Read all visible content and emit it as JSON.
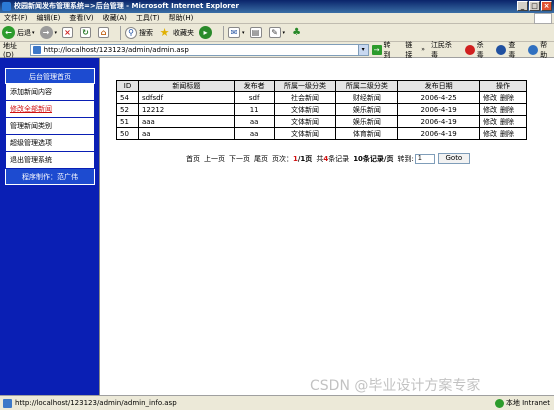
{
  "window": {
    "title": "校园新闻发布管理系统=>后台管理 - Microsoft Internet Explorer"
  },
  "menu": [
    "文件(F)",
    "编辑(E)",
    "查看(V)",
    "收藏(A)",
    "工具(T)",
    "帮助(H)"
  ],
  "toolbar": {
    "back": "后退",
    "search": "搜索",
    "favorites": "收藏夹"
  },
  "address": {
    "label": "地址(D)",
    "url": "http://localhost/123123/admin/admin.asp",
    "go": "转到",
    "links": "链接",
    "ext1": "江民杀毒",
    "ext2": "杀毒",
    "ext3": "查毒",
    "ext4": "帮助"
  },
  "sidebar": {
    "header": "后台管理首页",
    "items": [
      {
        "label": "添加新闻内容",
        "active": false
      },
      {
        "label": "修改全部新闻",
        "active": true
      },
      {
        "label": "管理新闻类别",
        "active": false
      },
      {
        "label": "超级管理选项",
        "active": false
      },
      {
        "label": "退出管理系统",
        "active": false
      }
    ],
    "footer": "程序制作：范广伟"
  },
  "table": {
    "headers": [
      "ID",
      "新闻标题",
      "发布者",
      "所属一级分类",
      "所属二级分类",
      "发布日期",
      "操作"
    ],
    "rows": [
      {
        "id": "54",
        "title": "sdfsdf",
        "author": "sdf",
        "cat1": "社会新闻",
        "cat2": "财经新闻",
        "date": "2006-4-25"
      },
      {
        "id": "52",
        "title": "12212",
        "author": "11",
        "cat1": "文体新闻",
        "cat2": "娱乐新闻",
        "date": "2006-4-19"
      },
      {
        "id": "51",
        "title": "aaa",
        "author": "aa",
        "cat1": "文体新闻",
        "cat2": "娱乐新闻",
        "date": "2006-4-19"
      },
      {
        "id": "50",
        "title": "aa",
        "author": "aa",
        "cat1": "文体新闻",
        "cat2": "体育新闻",
        "date": "2006-4-19"
      }
    ],
    "edit_label": "修改",
    "delete_label": "删除"
  },
  "pager": {
    "first": "首页",
    "prev": "上一页",
    "next": "下一页",
    "last": "尾页",
    "page_label": "页次：",
    "page_current": "1",
    "page_total": "/1页",
    "total_prefix": "共",
    "total_count": "4",
    "total_suffix": "条记录",
    "per_page": "10条记录/页",
    "jump_label": "转到:",
    "jump_value": "1",
    "goto": "Goto"
  },
  "status": {
    "url": "http://localhost/123123/admin/admin_info.asp",
    "zone": "本地 Intranet"
  },
  "watermark": "CSDN @毕业设计方案专家",
  "colors": {
    "sidebar_bg": "#0a1fb4",
    "sidebar_head": "#1d4bd0",
    "active_link": "#d01010"
  }
}
